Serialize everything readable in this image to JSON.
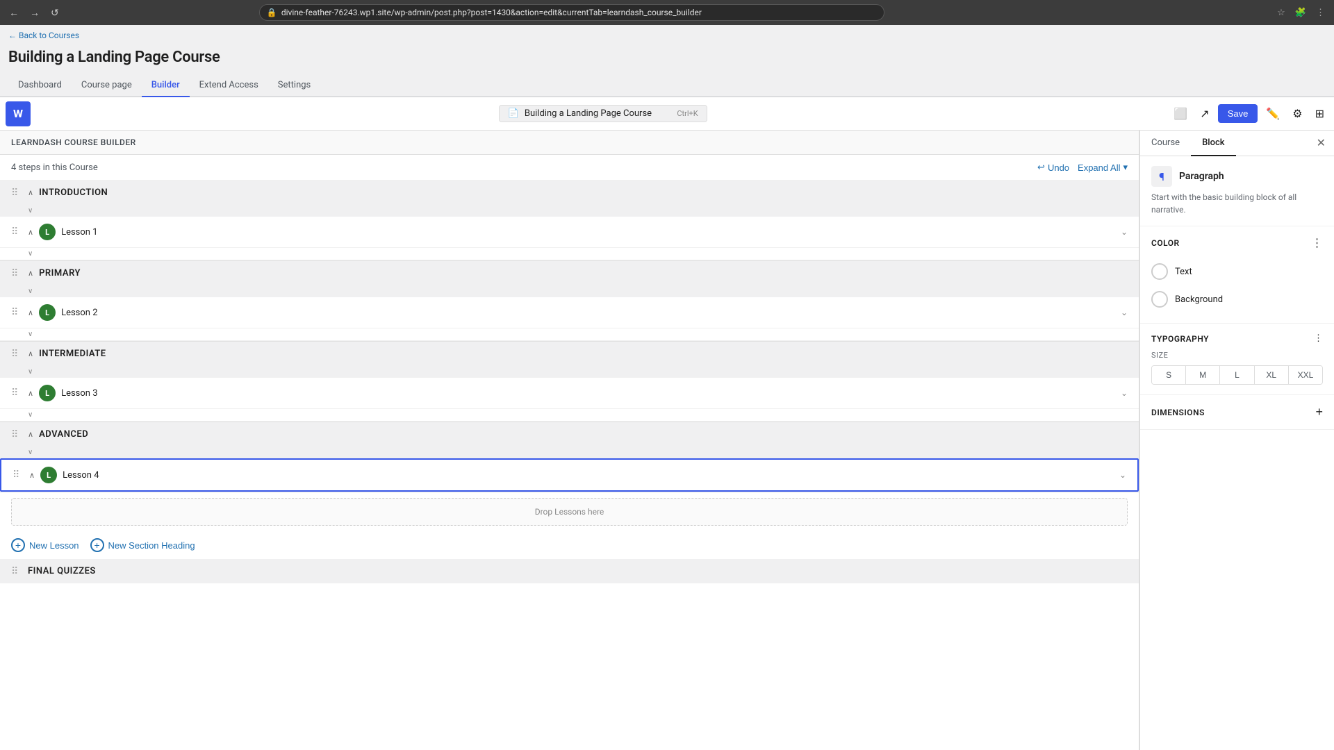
{
  "browser": {
    "url": "divine-feather-76243.wp1.site/wp-admin/post.php?post=1430&action=edit&currentTab=learndash_course_builder",
    "back_btn": "←",
    "forward_btn": "→",
    "refresh_btn": "↺"
  },
  "breadcrumb": "← Back to Courses",
  "page_title": "Building a Landing Page Course",
  "tabs": [
    {
      "id": "dashboard",
      "label": "Dashboard",
      "active": false
    },
    {
      "id": "course-page",
      "label": "Course page",
      "active": false
    },
    {
      "id": "builder",
      "label": "Builder",
      "active": true
    },
    {
      "id": "extend-access",
      "label": "Extend Access",
      "active": false
    },
    {
      "id": "settings",
      "label": "Settings",
      "active": false
    }
  ],
  "toolbar": {
    "wp_logo": "W",
    "post_title": "Building a Landing Page Course",
    "shortcut": "Ctrl+K",
    "save_label": "Save"
  },
  "builder": {
    "title": "LearnDash Course Builder",
    "steps_count": "4 steps in this Course",
    "undo_label": "Undo",
    "expand_all_label": "Expand All",
    "sections": [
      {
        "id": "introduction",
        "title": "INTRODUCTION",
        "lessons": [
          {
            "id": "lesson-1",
            "name": "Lesson 1",
            "icon": "L",
            "selected": false
          }
        ]
      },
      {
        "id": "primary",
        "title": "PRIMARY",
        "lessons": [
          {
            "id": "lesson-2",
            "name": "Lesson 2",
            "icon": "L",
            "selected": false
          }
        ]
      },
      {
        "id": "intermediate",
        "title": "INTERMEDIATE",
        "lessons": [
          {
            "id": "lesson-3",
            "name": "Lesson 3",
            "icon": "L",
            "selected": false
          }
        ]
      },
      {
        "id": "advanced",
        "title": "ADVANCED",
        "lessons": [
          {
            "id": "lesson-4",
            "name": "Lesson 4",
            "icon": "L",
            "selected": true
          }
        ]
      }
    ],
    "drop_zone_label": "Drop Lessons here",
    "add_lesson_label": "New Lesson",
    "add_section_label": "New Section Heading",
    "final_section": "FINAL QUIZZES"
  },
  "panel": {
    "tabs": [
      {
        "id": "course",
        "label": "Course",
        "active": false
      },
      {
        "id": "block",
        "label": "Block",
        "active": true
      }
    ],
    "block": {
      "icon": "¶",
      "type_label": "Paragraph",
      "description": "Start with the basic building block of all narrative."
    },
    "color": {
      "section_title": "Color",
      "options": [
        {
          "id": "text",
          "label": "Text"
        },
        {
          "id": "background",
          "label": "Background"
        }
      ]
    },
    "typography": {
      "section_title": "Typography",
      "size_label": "SIZE",
      "sizes": [
        {
          "id": "s",
          "label": "S"
        },
        {
          "id": "m",
          "label": "M"
        },
        {
          "id": "l",
          "label": "L"
        },
        {
          "id": "xl",
          "label": "XL"
        },
        {
          "id": "xxl",
          "label": "XXL"
        }
      ]
    },
    "dimensions": {
      "section_title": "Dimensions"
    }
  }
}
